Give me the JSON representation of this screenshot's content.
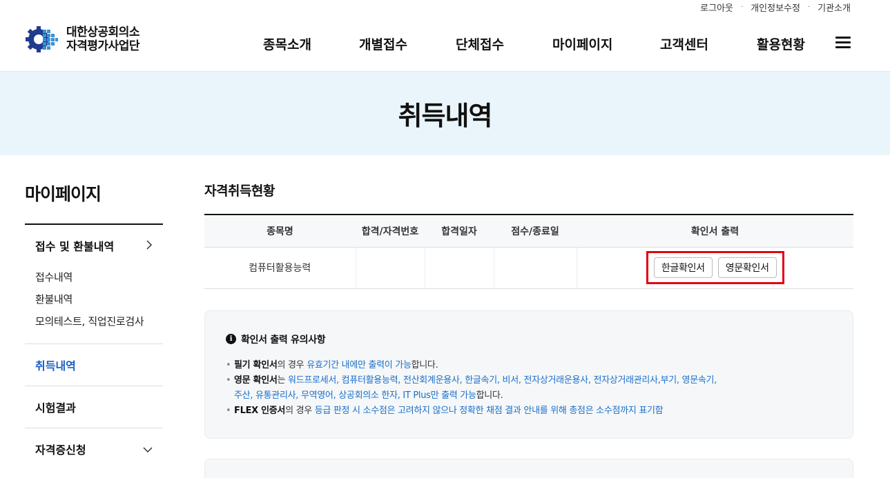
{
  "header": {
    "util": [
      "로그아웃",
      "개인정보수정",
      "기관소개"
    ],
    "logo_line1": "대한상공회의소",
    "logo_line2": "자격평가사업단",
    "nav": [
      "종목소개",
      "개별접수",
      "단체접수",
      "마이페이지",
      "고객센터",
      "활용현황"
    ]
  },
  "banner": {
    "title": "취득내역"
  },
  "sidebar": {
    "title": "마이페이지",
    "group1": {
      "label": "접수 및 환불내역",
      "items": [
        "접수내역",
        "환불내역",
        "모의테스트, 직업진로검사"
      ]
    },
    "item_active": "취득내역",
    "item_results": "시험결과",
    "item_cert": "자격증신청"
  },
  "main": {
    "section_title": "자격취득현황",
    "columns": [
      "종목명",
      "합격/자격번호",
      "합격일자",
      "점수/종료일",
      "확인서 출력"
    ],
    "rows": [
      {
        "name": "컴퓨터활용능력",
        "number": "",
        "date": "",
        "score": "",
        "btn_kor": "한글확인서",
        "btn_eng": "영문확인서"
      }
    ]
  },
  "notice": {
    "title": "확인서 출력 유의사항",
    "line1_b": "필기 확인서",
    "line1_a": "의 경우 ",
    "line1_blue": "유효기간 내에만 출력이 가능",
    "line1_c": "합니다.",
    "line2_b": "영문 확인서",
    "line2_a": "는 ",
    "line2_blue1": "워드프로세서, 컴퓨터활용능력, 전산회계운용사, 한글속기, 비서, 전자상거래운용사, 전자상거래관리사,부기, 영문속기,",
    "line2_blue2": "주산, 유통관리사, 무역영어, 상공회의소 한자, IT Plus만 출력 가능",
    "line2_c": "합니다.",
    "line3_b": "FLEX 인증서",
    "line3_a": "의 경우 ",
    "line3_blue": "등급 판정 시 소수점은 고려하지 않으나 정확한 채점 결과 안내를 위해 총점은 소수점까지 표기함"
  }
}
